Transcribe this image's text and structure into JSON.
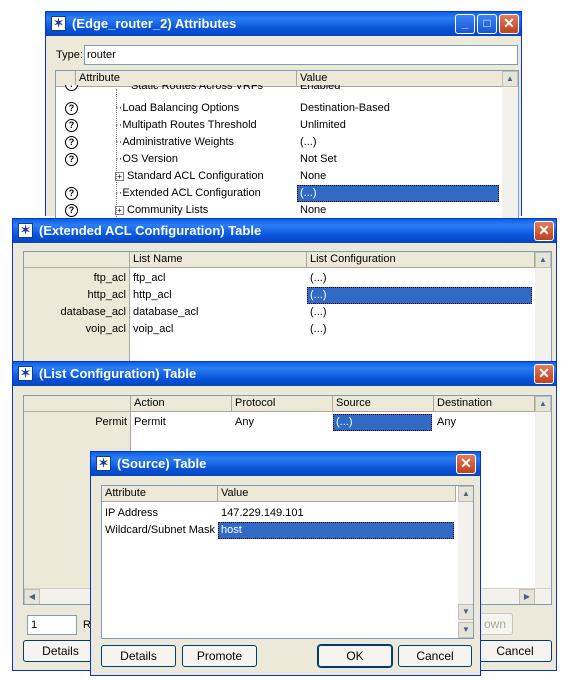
{
  "w1": {
    "title": "(Edge_router_2) Attributes",
    "type_label": "Type:",
    "type_value": "router",
    "col_attribute": "Attribute",
    "col_value": "Value",
    "rows": [
      {
        "attr": "Static Routes Across VRFs",
        "value": "Enabled"
      },
      {
        "attr": "Load Balancing Options",
        "value": "Destination-Based"
      },
      {
        "attr": "Multipath Routes Threshold",
        "value": "Unlimited"
      },
      {
        "attr": "Administrative Weights",
        "value": "(...)"
      },
      {
        "attr": "OS Version",
        "value": "Not Set"
      },
      {
        "attr": "Standard ACL Configuration",
        "value": "None"
      },
      {
        "attr": "Extended ACL Configuration",
        "value": "(...)"
      },
      {
        "attr": "Community Lists",
        "value": "None"
      }
    ]
  },
  "w2": {
    "title": "(Extended ACL Configuration) Table",
    "col_list_name": "List Name",
    "col_list_config": "List Configuration",
    "rows": [
      {
        "header": "ftp_acl",
        "name": "ftp_acl",
        "config": "(...)"
      },
      {
        "header": "http_acl",
        "name": "http_acl",
        "config": "(...)"
      },
      {
        "header": "database_acl",
        "name": "database_acl",
        "config": "(...)"
      },
      {
        "header": "voip_acl",
        "name": "voip_acl",
        "config": "(...)"
      }
    ]
  },
  "w3": {
    "title": "(List Configuration) Table",
    "col_action": "Action",
    "col_protocol": "Protocol",
    "col_source": "Source",
    "col_destination": "Destination",
    "row": {
      "header": "Permit",
      "action": "Permit",
      "protocol": "Any",
      "source": "(...)",
      "destination": "Any"
    },
    "rows_count": "1",
    "rows_label": "R",
    "down_btn": "own",
    "details_btn": "Details",
    "cancel_btn": "Cancel"
  },
  "w4": {
    "title": "(Source) Table",
    "col_attribute": "Attribute",
    "col_value": "Value",
    "rows": [
      {
        "attr": "IP Address",
        "value": "147.229.149.101"
      },
      {
        "attr": "Wildcard/Subnet Mask",
        "value": "host"
      }
    ],
    "details_btn": "Details",
    "promote_btn": "Promote",
    "ok_btn": "OK",
    "cancel_btn": "Cancel"
  }
}
